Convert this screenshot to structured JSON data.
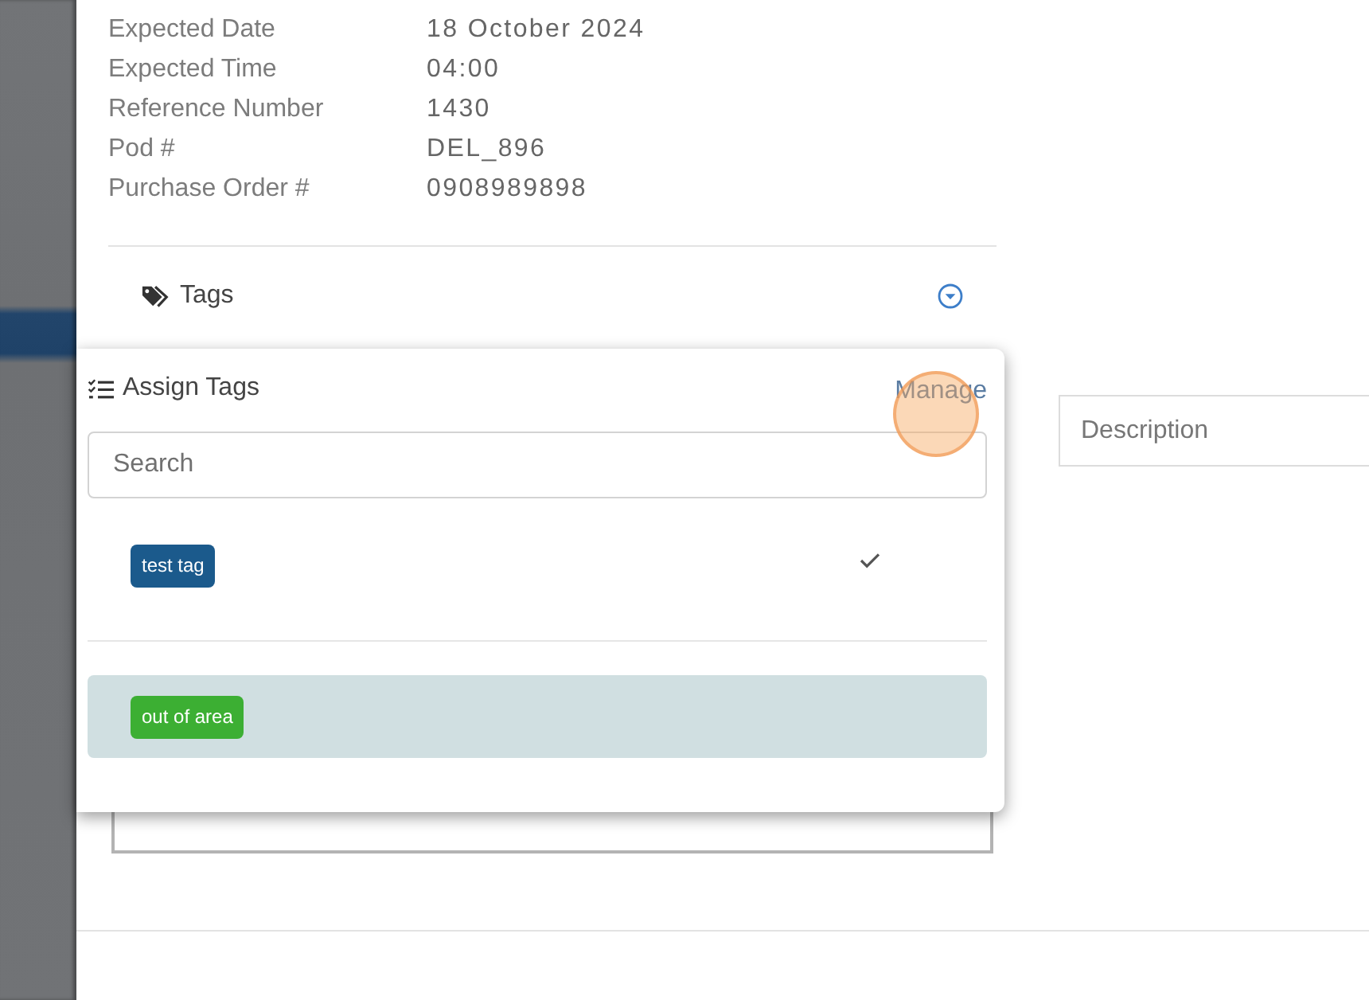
{
  "details": [
    {
      "label": "Expected Date",
      "value": "18 October 2024"
    },
    {
      "label": "Expected Time",
      "value": "04:00"
    },
    {
      "label": "Reference Number",
      "value": "1430"
    },
    {
      "label": "Pod #",
      "value": "DEL_896"
    },
    {
      "label": "Purchase Order #",
      "value": "0908989898"
    }
  ],
  "tags_section": {
    "title": "Tags"
  },
  "assign_tags": {
    "title": "Assign Tags",
    "manage_link": "Manage",
    "search": {
      "placeholder": "Search"
    },
    "tags": [
      {
        "label": "test tag",
        "color": "#1b5a8c",
        "selected": true,
        "highlighted": false
      },
      {
        "label": "out of area",
        "color": "#3caf33",
        "selected": false,
        "highlighted": true
      }
    ]
  },
  "description": {
    "placeholder": "Description"
  }
}
